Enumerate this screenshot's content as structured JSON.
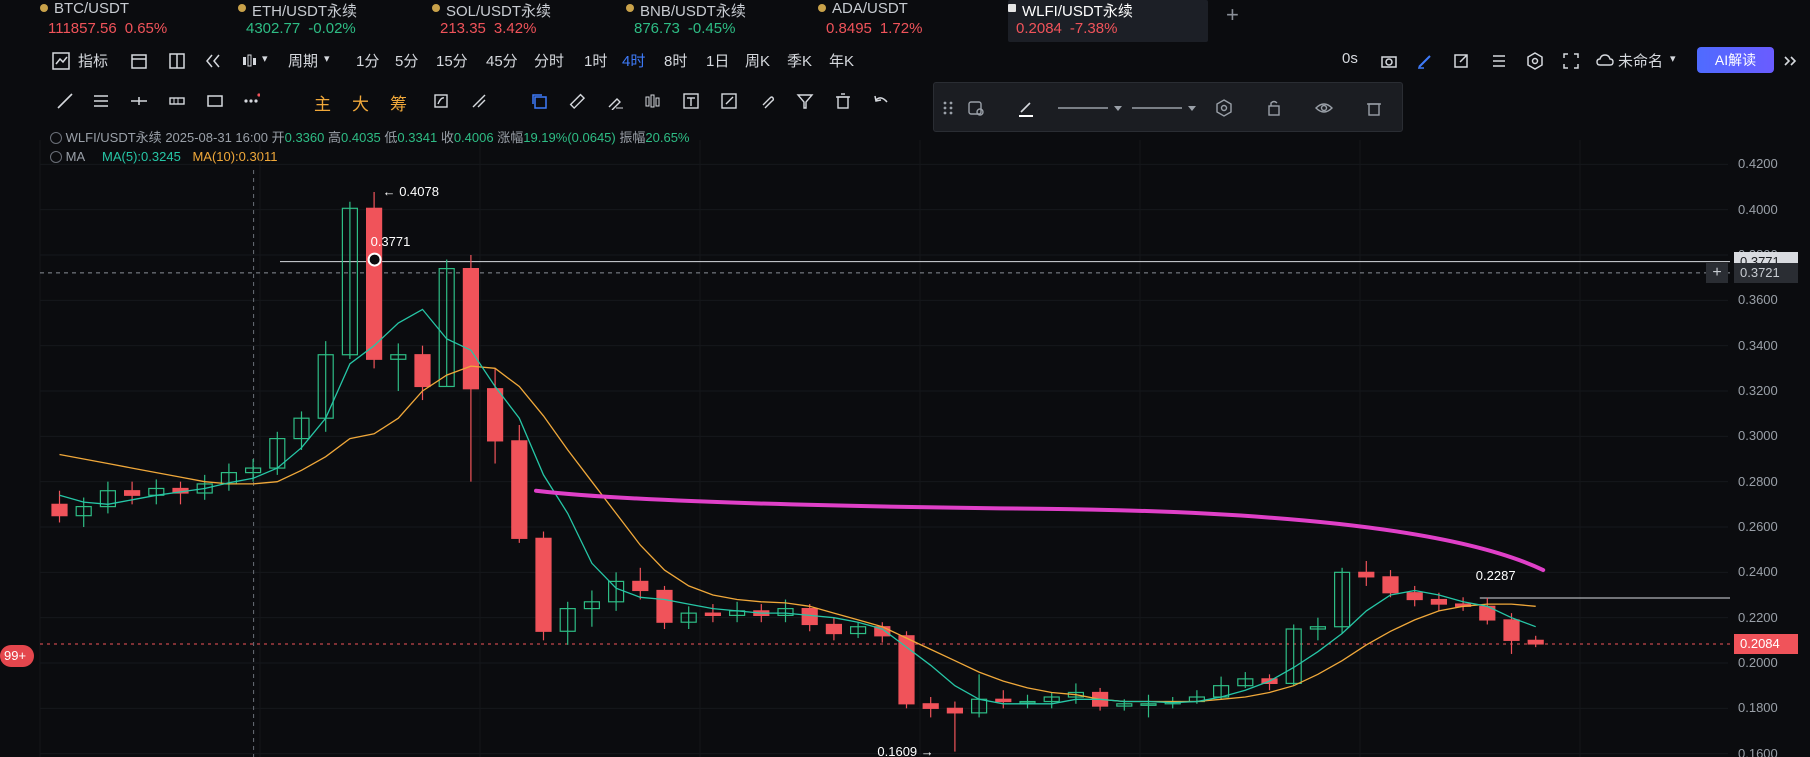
{
  "tickers": [
    {
      "symbol": "BTC/USDT",
      "price": "111857.56",
      "change": "0.65%",
      "dir": "down"
    },
    {
      "symbol": "ETH/USDT永续",
      "price": "4302.77",
      "change": "-0.02%",
      "dir": "up"
    },
    {
      "symbol": "SOL/USDT永续",
      "price": "213.35",
      "change": "3.42%",
      "dir": "down"
    },
    {
      "symbol": "BNB/USDT永续",
      "price": "876.73",
      "change": "-0.45%",
      "dir": "up"
    },
    {
      "symbol": "ADA/USDT",
      "price": "0.8495",
      "change": "1.72%",
      "dir": "down"
    },
    {
      "symbol": "WLFI/USDT永续",
      "price": "0.2084",
      "change": "-7.38%",
      "dir": "down",
      "active": true
    }
  ],
  "add_tab": "+",
  "toolbar": {
    "indicator": "指标",
    "period": "周期",
    "intervals": [
      "1分",
      "5分",
      "15分",
      "45分",
      "分时",
      "1时",
      "4时",
      "8时",
      "1日",
      "周K",
      "季K",
      "年K"
    ],
    "active_interval": "4时",
    "countdown": "0s",
    "layout_name": "未命名",
    "ai_label": "AI解读"
  },
  "draw_tools": {
    "main": "主",
    "large": "大",
    "chips": "筹"
  },
  "legend": {
    "symbol_line": "WLFI/USDT永续",
    "time": "2025-08-31 16:00",
    "open_label": "开",
    "open": "0.3360",
    "high_label": "高",
    "high": "0.4035",
    "low_label": "低",
    "low": "0.3341",
    "close_label": "收",
    "close": "0.4006",
    "change_label": "涨幅",
    "change": "19.19%(0.0645)",
    "amp_label": "振幅",
    "amp": "20.65%",
    "ma_label": "MA",
    "ma5": "MA(5):0.3245",
    "ma10": "MA(10):0.3011"
  },
  "annotations": {
    "high_marker": "← 0.4078",
    "hline_label": "0.3771",
    "low_marker": "0.1609 →",
    "right_label": "0.2287"
  },
  "price_axis": [
    "0.4200",
    "0.4000",
    "0.3800",
    "0.3600",
    "0.3400",
    "0.3200",
    "0.3000",
    "0.2800",
    "0.2600",
    "0.2400",
    "0.2200",
    "0.2000",
    "0.1800",
    "0.1600"
  ],
  "price_tags": {
    "hline": "0.3771",
    "crosshair": "0.3721",
    "current": "0.2084"
  },
  "badge": "99+",
  "colors": {
    "up": "#2ebd85",
    "down": "#f0535a",
    "ma5": "#26c6a6",
    "ma10": "#f0a83a",
    "trend": "#e040c8",
    "accent": "#3e7bfa"
  },
  "chart_data": {
    "type": "candlestick",
    "ylim": [
      0.155,
      0.425
    ],
    "candles": [
      [
        0.27,
        0.265,
        0.276,
        0.262
      ],
      [
        0.265,
        0.269,
        0.273,
        0.26
      ],
      [
        0.269,
        0.276,
        0.28,
        0.266
      ],
      [
        0.276,
        0.274,
        0.28,
        0.27
      ],
      [
        0.274,
        0.277,
        0.281,
        0.27
      ],
      [
        0.277,
        0.275,
        0.28,
        0.27
      ],
      [
        0.275,
        0.279,
        0.283,
        0.272
      ],
      [
        0.279,
        0.284,
        0.288,
        0.276
      ],
      [
        0.284,
        0.286,
        0.29,
        0.28
      ],
      [
        0.286,
        0.299,
        0.302,
        0.283
      ],
      [
        0.299,
        0.308,
        0.311,
        0.294
      ],
      [
        0.308,
        0.336,
        0.342,
        0.302
      ],
      [
        0.336,
        0.4006,
        0.4035,
        0.3341
      ],
      [
        0.4006,
        0.334,
        0.4078,
        0.33
      ],
      [
        0.334,
        0.336,
        0.341,
        0.32
      ],
      [
        0.336,
        0.322,
        0.34,
        0.316
      ],
      [
        0.322,
        0.374,
        0.378,
        0.322
      ],
      [
        0.374,
        0.321,
        0.38,
        0.28
      ],
      [
        0.321,
        0.298,
        0.33,
        0.288
      ],
      [
        0.298,
        0.255,
        0.305,
        0.253
      ],
      [
        0.255,
        0.214,
        0.258,
        0.21
      ],
      [
        0.214,
        0.224,
        0.227,
        0.208
      ],
      [
        0.224,
        0.227,
        0.232,
        0.216
      ],
      [
        0.227,
        0.236,
        0.24,
        0.223
      ],
      [
        0.236,
        0.232,
        0.242,
        0.228
      ],
      [
        0.232,
        0.218,
        0.234,
        0.215
      ],
      [
        0.218,
        0.222,
        0.225,
        0.215
      ],
      [
        0.222,
        0.221,
        0.226,
        0.218
      ],
      [
        0.221,
        0.223,
        0.227,
        0.218
      ],
      [
        0.223,
        0.221,
        0.226,
        0.218
      ],
      [
        0.221,
        0.224,
        0.228,
        0.218
      ],
      [
        0.224,
        0.217,
        0.226,
        0.214
      ],
      [
        0.217,
        0.213,
        0.22,
        0.21
      ],
      [
        0.213,
        0.216,
        0.218,
        0.211
      ],
      [
        0.216,
        0.212,
        0.218,
        0.209
      ],
      [
        0.212,
        0.182,
        0.214,
        0.18
      ],
      [
        0.182,
        0.18,
        0.185,
        0.176
      ],
      [
        0.18,
        0.178,
        0.183,
        0.1609
      ],
      [
        0.178,
        0.184,
        0.195,
        0.176
      ],
      [
        0.184,
        0.183,
        0.188,
        0.18
      ],
      [
        0.183,
        0.183,
        0.186,
        0.18
      ],
      [
        0.183,
        0.185,
        0.187,
        0.18
      ],
      [
        0.185,
        0.187,
        0.191,
        0.182
      ],
      [
        0.187,
        0.181,
        0.189,
        0.179
      ],
      [
        0.181,
        0.182,
        0.184,
        0.179
      ],
      [
        0.182,
        0.182,
        0.186,
        0.176
      ],
      [
        0.182,
        0.183,
        0.185,
        0.18
      ],
      [
        0.183,
        0.185,
        0.188,
        0.182
      ],
      [
        0.185,
        0.19,
        0.194,
        0.184
      ],
      [
        0.19,
        0.193,
        0.196,
        0.189
      ],
      [
        0.193,
        0.191,
        0.195,
        0.188
      ],
      [
        0.191,
        0.215,
        0.217,
        0.19
      ],
      [
        0.215,
        0.216,
        0.22,
        0.21
      ],
      [
        0.216,
        0.24,
        0.242,
        0.213
      ],
      [
        0.24,
        0.238,
        0.245,
        0.234
      ],
      [
        0.238,
        0.231,
        0.241,
        0.229
      ],
      [
        0.231,
        0.228,
        0.234,
        0.225
      ],
      [
        0.228,
        0.226,
        0.231,
        0.223
      ],
      [
        0.226,
        0.225,
        0.229,
        0.223
      ],
      [
        0.225,
        0.219,
        0.2287,
        0.217
      ],
      [
        0.219,
        0.21,
        0.222,
        0.204
      ],
      [
        0.21,
        0.2084,
        0.212,
        0.207
      ]
    ],
    "ma5": [
      0.274,
      0.271,
      0.27,
      0.272,
      0.274,
      0.2755,
      0.277,
      0.2795,
      0.2815,
      0.286,
      0.295,
      0.308,
      0.332,
      0.34,
      0.35,
      0.356,
      0.343,
      0.338,
      0.322,
      0.308,
      0.283,
      0.266,
      0.244,
      0.233,
      0.229,
      0.228,
      0.226,
      0.224,
      0.223,
      0.222,
      0.222,
      0.221,
      0.22,
      0.218,
      0.215,
      0.207,
      0.199,
      0.19,
      0.184,
      0.182,
      0.182,
      0.182,
      0.184,
      0.184,
      0.183,
      0.183,
      0.1825,
      0.183,
      0.185,
      0.188,
      0.192,
      0.198,
      0.205,
      0.213,
      0.223,
      0.23,
      0.232,
      0.23,
      0.227,
      0.225,
      0.22,
      0.216
    ],
    "ma10": [
      0.292,
      0.29,
      0.288,
      0.286,
      0.284,
      0.282,
      0.28,
      0.279,
      0.279,
      0.28,
      0.285,
      0.291,
      0.299,
      0.3011,
      0.308,
      0.32,
      0.327,
      0.331,
      0.33,
      0.322,
      0.309,
      0.294,
      0.28,
      0.266,
      0.252,
      0.241,
      0.234,
      0.23,
      0.228,
      0.227,
      0.2265,
      0.225,
      0.222,
      0.219,
      0.216,
      0.211,
      0.206,
      0.201,
      0.196,
      0.192,
      0.189,
      0.187,
      0.186,
      0.184,
      0.183,
      0.183,
      0.183,
      0.183,
      0.184,
      0.185,
      0.187,
      0.19,
      0.195,
      0.201,
      0.208,
      0.214,
      0.219,
      0.223,
      0.225,
      0.226,
      0.226,
      0.225
    ],
    "trend_line": {
      "from_index": 20,
      "from_value": 0.276,
      "to_index": 61,
      "to_value": 0.241
    },
    "hline_value": 0.3771,
    "crosshair_value": 0.3721,
    "current_value": 0.2084,
    "right_hline_value": 0.2287
  }
}
